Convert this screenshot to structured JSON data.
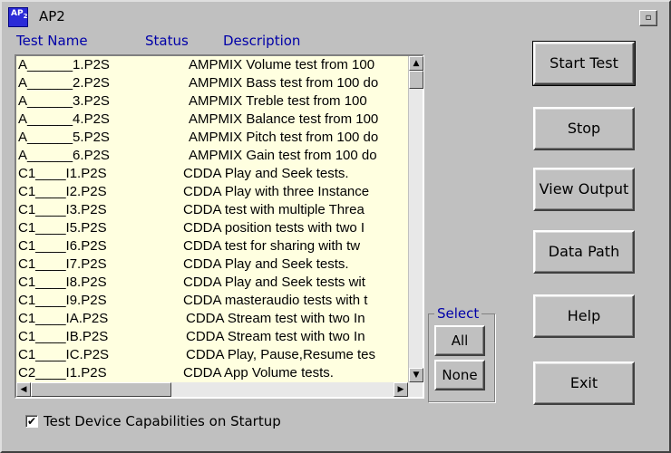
{
  "window": {
    "title": "AP2",
    "icon_text": "AP",
    "icon_sub": "2"
  },
  "headers": {
    "name": "Test Name",
    "status": "Status",
    "description": "Description"
  },
  "tests": [
    {
      "name": "A______1.P2S",
      "description": "AMPMIX Volume test from 100"
    },
    {
      "name": "A______2.P2S",
      "description": "AMPMIX Bass test from 100 do"
    },
    {
      "name": "A______3.P2S",
      "description": "AMPMIX Treble test from 100"
    },
    {
      "name": "A______4.P2S",
      "description": "AMPMIX Balance test from 100"
    },
    {
      "name": "A______5.P2S",
      "description": "AMPMIX Pitch test from 100 do"
    },
    {
      "name": "A______6.P2S",
      "description": "AMPMIX Gain test from 100 do"
    },
    {
      "name": "C1____I1.P2S",
      "description": "CDDA Play and Seek tests."
    },
    {
      "name": "C1____I2.P2S",
      "description": "CDDA Play with three Instance"
    },
    {
      "name": "C1____I3.P2S",
      "description": "CDDA test with multiple Threa"
    },
    {
      "name": "C1____I5.P2S",
      "description": "CDDA position tests with two I"
    },
    {
      "name": "C1____I6.P2S",
      "description": "CDDA test for sharing with tw"
    },
    {
      "name": "C1____I7.P2S",
      "description": "CDDA Play and Seek tests."
    },
    {
      "name": "C1____I8.P2S",
      "description": "CDDA Play and Seek tests wit"
    },
    {
      "name": "C1____I9.P2S",
      "description": "CDDA masteraudio tests with t"
    },
    {
      "name": "C1____IA.P2S",
      "description": "CDDA Stream test with two In"
    },
    {
      "name": "C1____IB.P2S",
      "description": "CDDA Stream test with two In"
    },
    {
      "name": "C1____IC.P2S",
      "description": "CDDA Play, Pause,Resume tes"
    },
    {
      "name": "C2____I1.P2S",
      "description": "CDDA App Volume tests."
    }
  ],
  "buttons": {
    "start": "Start Test",
    "stop": "Stop",
    "view_output": "View Output",
    "data_path": "Data Path",
    "help": "Help",
    "exit": "Exit"
  },
  "select": {
    "label": "Select",
    "all": "All",
    "none": "None"
  },
  "checkbox": {
    "label": "Test Device Capabilities on Startup",
    "checked": true,
    "mark": "✔"
  },
  "scroll": {
    "up": "▲",
    "down": "▼",
    "left": "◀",
    "right": "▶"
  }
}
